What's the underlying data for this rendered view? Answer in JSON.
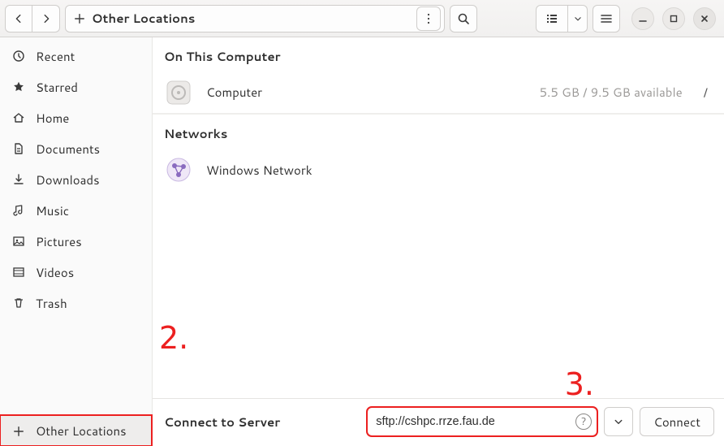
{
  "header": {
    "path_label": "Other Locations"
  },
  "sidebar": {
    "items": [
      {
        "label": "Recent"
      },
      {
        "label": "Starred"
      },
      {
        "label": "Home"
      },
      {
        "label": "Documents"
      },
      {
        "label": "Downloads"
      },
      {
        "label": "Music"
      },
      {
        "label": "Pictures"
      },
      {
        "label": "Videos"
      },
      {
        "label": "Trash"
      }
    ],
    "other_label": "Other Locations"
  },
  "main": {
    "section_on_this": "On This Computer",
    "computer_label": "Computer",
    "computer_sub": "5.5 GB / 9.5 GB available",
    "computer_path": "/",
    "section_networks": "Networks",
    "windows_network_label": "Windows Network"
  },
  "connect": {
    "label": "Connect to Server",
    "value": "sftp://cshpc.rrze.fau.de",
    "placeholder": "",
    "button_label": "Connect"
  },
  "annotations": {
    "step2": "2.",
    "step3": "3."
  }
}
